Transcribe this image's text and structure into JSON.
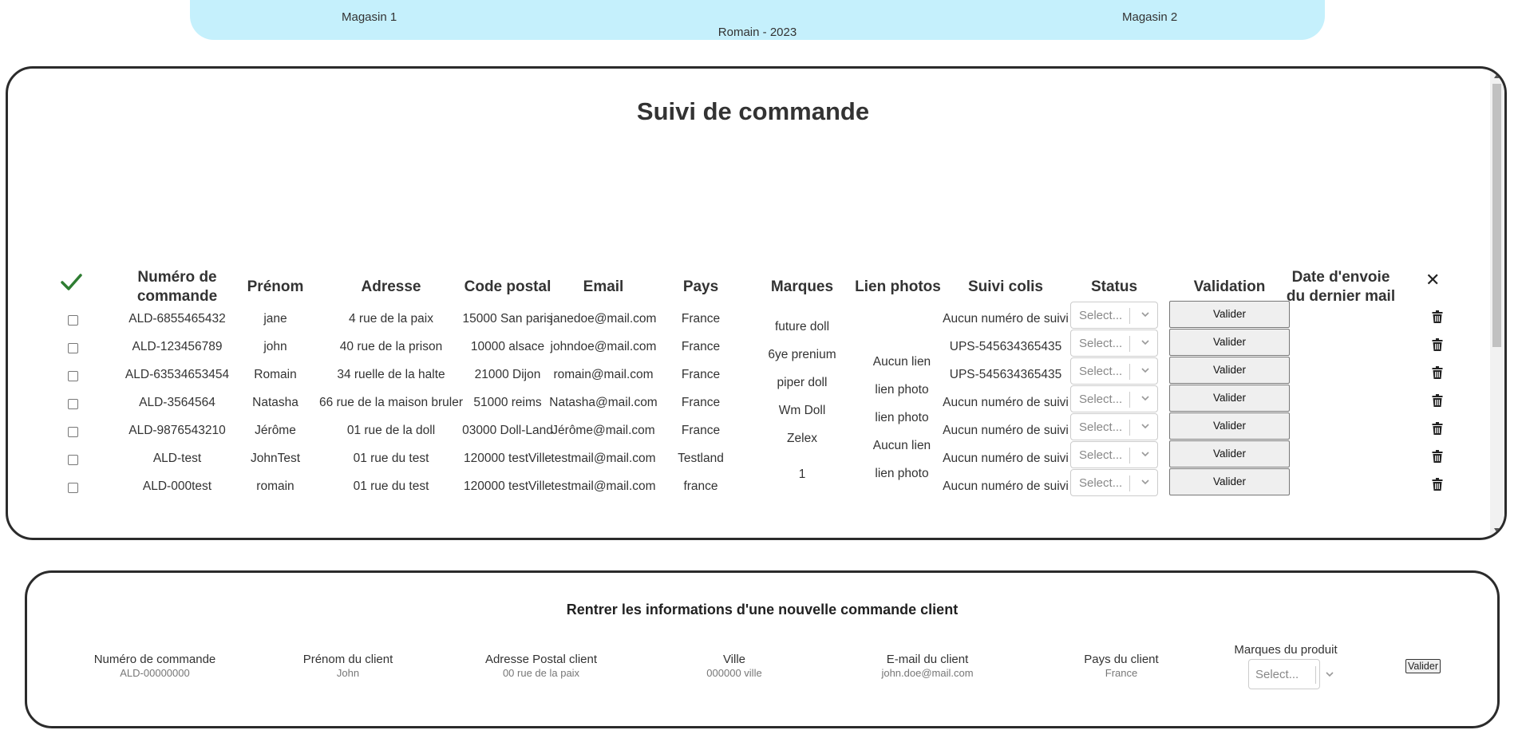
{
  "topbar": {
    "store1": "Magasin 1",
    "store2": "Magasin 2",
    "subtitle": "Romain - 2023"
  },
  "orders_panel": {
    "title": "Suivi de commande",
    "columns": {
      "order_number_line1": "Numéro de",
      "order_number_line2": "commande",
      "first_name": "Prénom",
      "address": "Adresse",
      "postal_code": "Code postal",
      "email": "Email",
      "country": "Pays",
      "brands": "Marques",
      "photo_links": "Lien photos",
      "tracking": "Suivi colis",
      "status": "Status",
      "validation": "Validation",
      "last_mail_line1": "Date d'envoie",
      "last_mail_line2": "du dernier mail"
    },
    "select_placeholder": "Select...",
    "validate_label": "Valider",
    "rows": [
      {
        "order": "ALD-6855465432",
        "first": "jane",
        "address": "4 rue de la paix",
        "postal": "15000 San paris",
        "email": "janedoe@mail.com",
        "country": "France",
        "tracking": "Aucun numéro de suivi"
      },
      {
        "order": "ALD-123456789",
        "first": "john",
        "address": "40 rue de la prison",
        "postal": "10000 alsace",
        "email": "johndoe@mail.com",
        "country": "France",
        "tracking": "UPS-545634365435"
      },
      {
        "order": "ALD-63534653454",
        "first": "Romain",
        "address": "34 ruelle de la halte",
        "postal": "21000 Dijon",
        "email": "romain@mail.com",
        "country": "France",
        "tracking": "UPS-545634365435"
      },
      {
        "order": "ALD-3564564",
        "first": "Natasha",
        "address": "66 rue de la maison bruler",
        "postal": "51000 reims",
        "email": "Natasha@mail.com",
        "country": "France",
        "tracking": "Aucun numéro de suivi"
      },
      {
        "order": "ALD-9876543210",
        "first": "Jérôme",
        "address": "01 rue de la doll",
        "postal": "03000 Doll-Land",
        "email": "Jérôme@mail.com",
        "country": "France",
        "tracking": "Aucun numéro de suivi"
      },
      {
        "order": "ALD-test",
        "first": "JohnTest",
        "address": "01 rue du test",
        "postal": "120000 testVille",
        "email": "testmail@mail.com",
        "country": "Testland",
        "tracking": "Aucun numéro de suivi"
      },
      {
        "order": "ALD-000test",
        "first": "romain",
        "address": "01 rue du test",
        "postal": "120000 testVille",
        "email": "testmail@mail.com",
        "country": "france",
        "tracking": "Aucun numéro de suivi"
      }
    ],
    "brands": [
      "future doll",
      "6ye prenium",
      "piper doll",
      "Wm Doll",
      "Zelex",
      "1"
    ],
    "photo_links": [
      "Aucun lien",
      "lien photo",
      "lien photo",
      "Aucun lien",
      "lien photo"
    ]
  },
  "new_order_form": {
    "title": "Rentrer les informations d'une nouvelle commande client",
    "fields": [
      {
        "label": "Numéro de commande",
        "placeholder": "ALD-00000000"
      },
      {
        "label": "Prénom du client",
        "placeholder": "John"
      },
      {
        "label": "Adresse Postal client",
        "placeholder": "00 rue de la paix"
      },
      {
        "label": "Ville",
        "placeholder": "000000 ville"
      },
      {
        "label": "E-mail du client",
        "placeholder": "john.doe@mail.com"
      },
      {
        "label": "Pays du client",
        "placeholder": "France"
      }
    ],
    "brands_label": "Marques du produit",
    "brands_placeholder": "Select...",
    "submit_label": "Valider"
  },
  "colors": {
    "topbar": "#c5f0fc",
    "check": "#2e7d32",
    "border": "#2b2b2b"
  },
  "icons": {
    "header_check": "checkmark-icon",
    "header_close": "close-icon",
    "row_delete": "trash-icon",
    "select_arrow": "chevron-down-icon"
  }
}
